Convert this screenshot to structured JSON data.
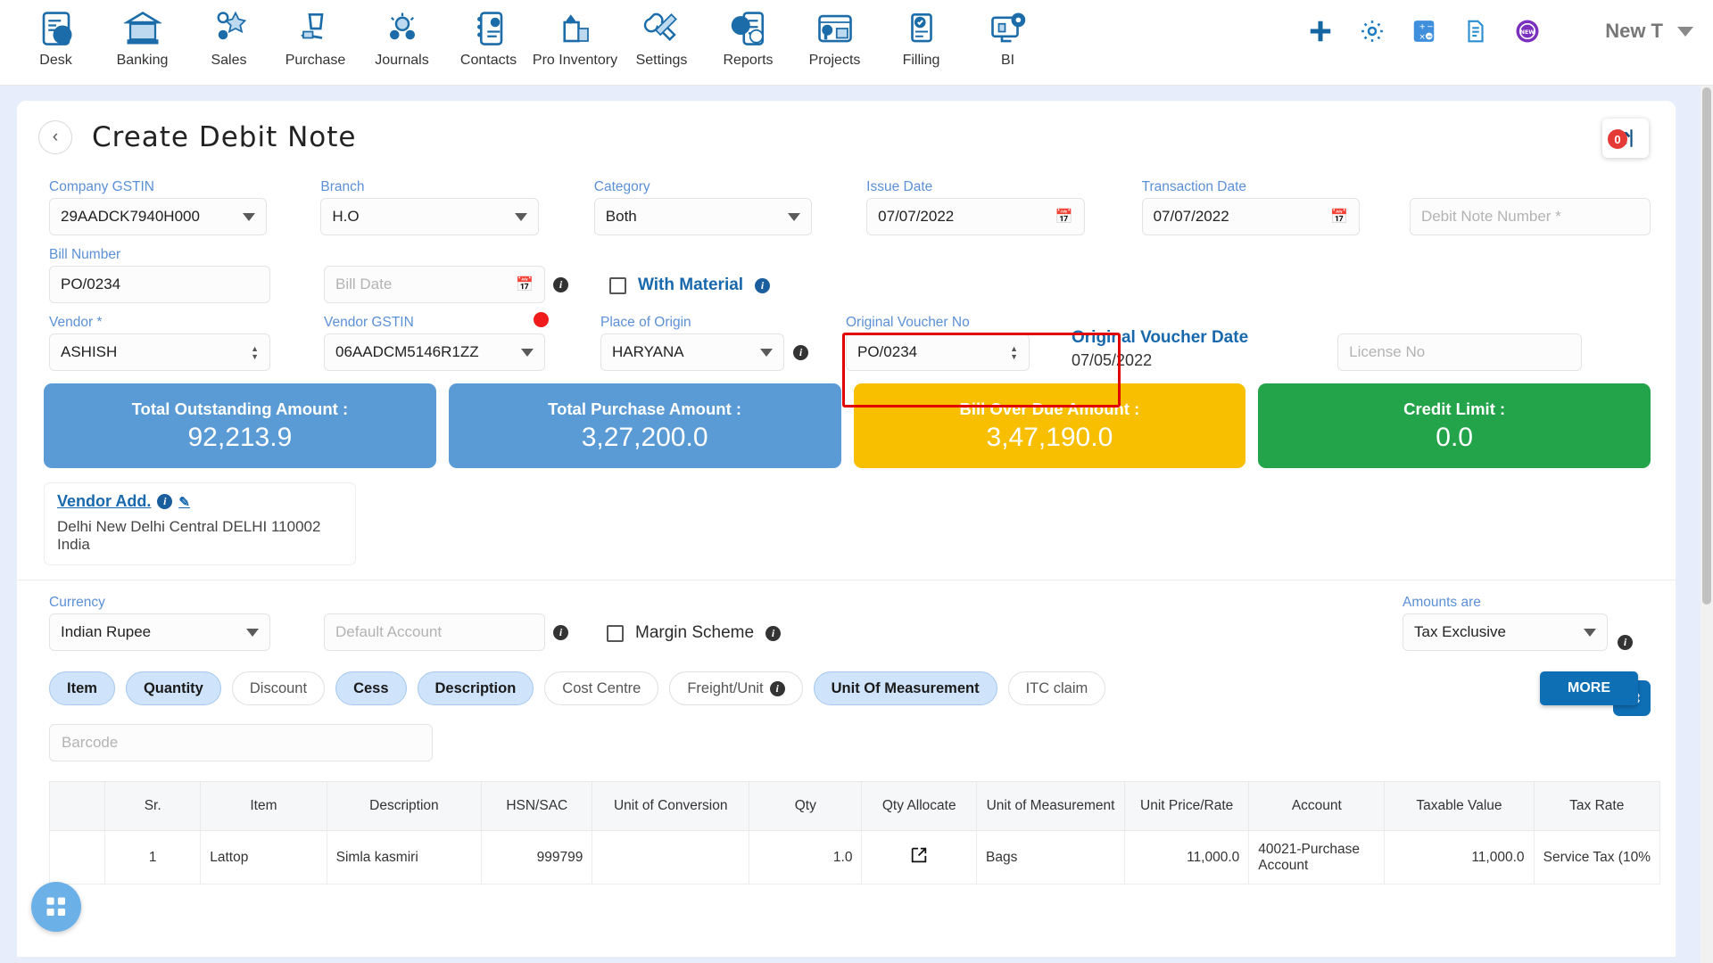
{
  "nav": {
    "items": [
      {
        "label": "Desk",
        "icon": "desk-chart-icon"
      },
      {
        "label": "Banking",
        "icon": "bank-icon"
      },
      {
        "label": "Sales",
        "icon": "sales-icon"
      },
      {
        "label": "Purchase",
        "icon": "purchase-hand-bag-icon"
      },
      {
        "label": "Journals",
        "icon": "journals-people-icon"
      },
      {
        "label": "Contacts",
        "icon": "contacts-card-icon"
      },
      {
        "label": "Pro Inventory",
        "icon": "inventory-box-icon"
      },
      {
        "label": "Settings",
        "icon": "settings-tools-icon"
      },
      {
        "label": "Reports",
        "icon": "reports-piechart-icon"
      },
      {
        "label": "Projects",
        "icon": "projects-dashboard-icon"
      },
      {
        "label": "Filling",
        "icon": "filling-check-doc-icon"
      },
      {
        "label": "BI",
        "icon": "bi-monitor-icon"
      }
    ],
    "actions": [
      {
        "icon": "plus-icon",
        "color": "#1565a0"
      },
      {
        "icon": "gear-icon",
        "color": "#1e7bbf"
      },
      {
        "icon": "calculator-icon",
        "color": "#3f8fdc"
      },
      {
        "icon": "document-icon",
        "color": "#2a8fd0"
      },
      {
        "icon": "new-badge-icon",
        "color": "#7b2fbe"
      }
    ],
    "user": "New T"
  },
  "header": {
    "title": "Create Debit Note",
    "back_icon": "chevron-left-icon",
    "upload_icon": "upload-icon",
    "upload_badge": "0"
  },
  "form": {
    "company_gstin": {
      "label": "Company GSTIN",
      "value": "29AADCK7940H000"
    },
    "branch": {
      "label": "Branch",
      "value": "H.O"
    },
    "category": {
      "label": "Category",
      "value": "Both"
    },
    "issue_date": {
      "label": "Issue Date",
      "value": "07/07/2022"
    },
    "transaction_date": {
      "label": "Transaction Date",
      "value": "07/07/2022"
    },
    "debit_note_number": {
      "placeholder": "Debit Note Number *"
    },
    "bill_number": {
      "label": "Bill Number",
      "value": "PO/0234"
    },
    "bill_date": {
      "placeholder": "Bill Date"
    },
    "with_material": {
      "label": "With Material",
      "checked": false
    },
    "vendor": {
      "label": "Vendor *",
      "value": "ASHISH"
    },
    "vendor_gstin": {
      "label": "Vendor GSTIN",
      "value": "06AADCM5146R1ZZ"
    },
    "place_of_origin": {
      "label": "Place of Origin",
      "value": "HARYANA"
    },
    "original_voucher_no": {
      "label": "Original Voucher No",
      "value": "PO/0234"
    },
    "original_voucher_date": {
      "label": "Original Voucher Date",
      "value": "07/05/2022"
    },
    "license_no": {
      "placeholder": "License No"
    },
    "currency": {
      "label": "Currency",
      "value": "Indian Rupee"
    },
    "default_account": {
      "placeholder": "Default Account"
    },
    "margin_scheme": {
      "label": "Margin Scheme",
      "checked": false
    },
    "amounts_are": {
      "label": "Amounts are",
      "value": "Tax Exclusive"
    }
  },
  "cards": [
    {
      "title": "Total Outstanding Amount :",
      "value": "92,213.9",
      "color": "#5b9bd5"
    },
    {
      "title": "Total Purchase Amount :",
      "value": "3,27,200.0",
      "color": "#5b9bd5"
    },
    {
      "title": "Bill Over Due Amount :",
      "value": "3,47,190.0",
      "color": "#f7bf00"
    },
    {
      "title": "Credit Limit :",
      "value": "0.0",
      "color": "#23a34a"
    }
  ],
  "vendor_address": {
    "title": "Vendor Add.",
    "body": "Delhi New Delhi Central DELHI 110002 India",
    "info_icon": "info-icon",
    "edit_icon": "edit-pencil-icon"
  },
  "chips": [
    {
      "label": "Item",
      "selected": true
    },
    {
      "label": "Quantity",
      "selected": true
    },
    {
      "label": "Discount",
      "selected": false
    },
    {
      "label": "Cess",
      "selected": true
    },
    {
      "label": "Description",
      "selected": true
    },
    {
      "label": "Cost Centre",
      "selected": false
    },
    {
      "label": "Freight/Unit",
      "selected": false,
      "info": true
    },
    {
      "label": "Unit Of Measurement",
      "selected": true
    },
    {
      "label": "ITC claim",
      "selected": false
    }
  ],
  "more_button": "MORE",
  "barcode": {
    "placeholder": "Barcode"
  },
  "table": {
    "columns": [
      "Sr.",
      "Item",
      "Description",
      "HSN/SAC",
      "Unit of Conversion",
      "Qty",
      "Qty Allocate",
      "Unit of Measurement",
      "Unit Price/Rate",
      "Account",
      "Taxable Value",
      "Tax Rate"
    ],
    "rows": [
      {
        "sr": "1",
        "item": "Lattop",
        "description": "Simla kasmiri",
        "hsn_sac": "999799",
        "unit_of_conversion": "",
        "qty": "1.0",
        "qty_allocate": "external-link-icon",
        "unit_of_measurement": "Bags",
        "unit_price_rate": "11,000.0",
        "account": "40021-Purchase Account",
        "taxable_value": "11,000.0",
        "tax_rate": "Service Tax (10%"
      }
    ]
  },
  "fab": {
    "icon": "grid-apps-icon"
  },
  "colors": {
    "accent": "#1868ad",
    "label_blue": "#5b90d6",
    "highlight_red": "#e00000"
  }
}
